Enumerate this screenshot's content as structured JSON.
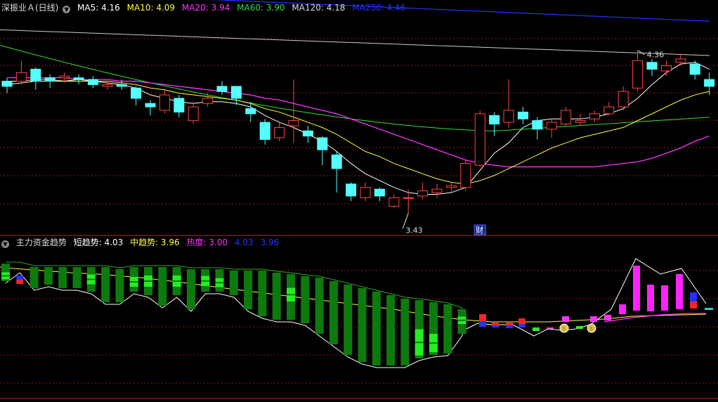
{
  "main_panel": {
    "title": "深振业Ａ(日线)",
    "ma": [
      {
        "label": "MA5: 4.16",
        "color": "#ffffff"
      },
      {
        "label": "MA10: 4.09",
        "color": "#ffff33"
      },
      {
        "label": "MA20: 3.94",
        "color": "#ff33ff"
      },
      {
        "label": "MA60: 3.90",
        "color": "#33dd33"
      },
      {
        "label": "MA120: 4.18",
        "color": "#dddddd"
      },
      {
        "label": "MA250: 4.46",
        "color": "#2233ff"
      }
    ],
    "high_label": "4.36",
    "low_label": "3.43",
    "event_badge": "财",
    "collapse_icon": "chevron-down-icon"
  },
  "sub_panel": {
    "title": "主力资金趋势",
    "items": [
      {
        "label": "短趋势: 4.03",
        "color": "#ffffff"
      },
      {
        "label": "中趋势: 3.96",
        "color": "#ffff33"
      },
      {
        "label": "热度: 3.00",
        "color": "#ff33ff"
      },
      {
        "label": "4.03",
        "color": "#2233ff"
      },
      {
        "label": "3.96",
        "color": "#2233ff"
      }
    ],
    "money_icon": "money-bag-icon"
  },
  "colors": {
    "up": "#ff4444",
    "down": "#54ffff",
    "grid": "#8a1a1a",
    "bg": "#000000"
  },
  "chart_data": {
    "type": "candlestick",
    "ylim": [
      3.3,
      4.6
    ],
    "candles": [
      [
        4.2,
        4.17,
        4.22,
        4.13
      ],
      [
        4.2,
        4.25,
        4.32,
        4.18
      ],
      [
        4.27,
        4.2,
        4.28,
        4.15
      ],
      [
        4.22,
        4.2,
        4.24,
        4.16
      ],
      [
        4.22,
        4.23,
        4.25,
        4.19
      ],
      [
        4.22,
        4.21,
        4.24,
        4.18
      ],
      [
        4.21,
        4.18,
        4.23,
        4.16
      ],
      [
        4.17,
        4.18,
        4.2,
        4.15
      ],
      [
        4.18,
        4.17,
        4.21,
        4.15
      ],
      [
        4.16,
        4.1,
        4.17,
        4.06
      ],
      [
        4.07,
        4.05,
        4.09,
        4.0
      ],
      [
        4.03,
        4.12,
        4.15,
        4.01
      ],
      [
        4.1,
        4.02,
        4.12,
        3.99
      ],
      [
        3.97,
        4.05,
        4.08,
        3.95
      ],
      [
        4.07,
        4.1,
        4.13,
        4.05
      ],
      [
        4.17,
        4.14,
        4.2,
        4.12
      ],
      [
        4.17,
        4.1,
        4.17,
        4.06
      ],
      [
        4.04,
        4.01,
        4.08,
        3.96
      ],
      [
        3.96,
        3.86,
        3.98,
        3.83
      ],
      [
        3.87,
        3.93,
        3.96,
        3.85
      ],
      [
        3.94,
        3.97,
        4.21,
        3.84
      ],
      [
        3.91,
        3.88,
        3.94,
        3.84
      ],
      [
        3.87,
        3.8,
        3.88,
        3.71
      ],
      [
        3.77,
        3.69,
        3.79,
        3.55
      ],
      [
        3.6,
        3.53,
        3.61,
        3.5
      ],
      [
        3.52,
        3.58,
        3.61,
        3.5
      ],
      [
        3.57,
        3.53,
        3.58,
        3.5
      ],
      [
        3.47,
        3.52,
        3.54,
        3.46
      ],
      [
        3.52,
        3.52,
        3.57,
        3.43
      ],
      [
        3.53,
        3.56,
        3.61,
        3.51
      ],
      [
        3.55,
        3.57,
        3.6,
        3.52
      ],
      [
        3.58,
        3.59,
        3.61,
        3.55
      ],
      [
        3.58,
        3.72,
        3.74,
        3.56
      ],
      [
        3.71,
        4.01,
        4.03,
        3.7
      ],
      [
        4.0,
        3.95,
        4.02,
        3.88
      ],
      [
        3.96,
        4.03,
        4.21,
        3.93
      ],
      [
        4.02,
        3.98,
        4.05,
        3.95
      ],
      [
        3.97,
        3.92,
        3.99,
        3.86
      ],
      [
        3.92,
        3.96,
        3.98,
        3.87
      ],
      [
        3.95,
        4.03,
        4.05,
        3.94
      ],
      [
        3.96,
        3.97,
        4.01,
        3.94
      ],
      [
        3.98,
        4.01,
        4.03,
        3.96
      ],
      [
        4.01,
        4.05,
        4.08,
        4.0
      ],
      [
        4.05,
        4.14,
        4.17,
        4.03
      ],
      [
        4.16,
        4.32,
        4.38,
        4.14
      ],
      [
        4.31,
        4.27,
        4.33,
        4.23
      ],
      [
        4.26,
        4.29,
        4.32,
        4.23
      ],
      [
        4.31,
        4.33,
        4.36,
        4.29
      ],
      [
        4.3,
        4.24,
        4.32,
        4.21
      ],
      [
        4.21,
        4.17,
        4.25,
        4.12
      ]
    ],
    "ma5": [
      4.18,
      4.19,
      4.2,
      4.2,
      4.2,
      4.21,
      4.2,
      4.19,
      4.18,
      4.16,
      4.12,
      4.1,
      4.08,
      4.07,
      4.08,
      4.08,
      4.07,
      4.05,
      4.0,
      3.96,
      3.93,
      3.89,
      3.85,
      3.79,
      3.72,
      3.66,
      3.62,
      3.58,
      3.55,
      3.54,
      3.54,
      3.55,
      3.58,
      3.68,
      3.78,
      3.84,
      3.93,
      3.97,
      3.98,
      3.98,
      3.98,
      3.99,
      4.01,
      4.04,
      4.1,
      4.18,
      4.25,
      4.3,
      4.31,
      4.27
    ],
    "ma10": [
      4.2,
      4.2,
      4.21,
      4.21,
      4.2,
      4.2,
      4.2,
      4.2,
      4.19,
      4.18,
      4.16,
      4.15,
      4.13,
      4.12,
      4.11,
      4.1,
      4.09,
      4.07,
      4.04,
      4.02,
      3.99,
      3.96,
      3.93,
      3.89,
      3.84,
      3.79,
      3.76,
      3.72,
      3.69,
      3.66,
      3.63,
      3.61,
      3.6,
      3.62,
      3.65,
      3.69,
      3.73,
      3.77,
      3.81,
      3.84,
      3.87,
      3.89,
      3.91,
      3.93,
      3.97,
      4.01,
      4.05,
      4.09,
      4.12,
      4.14
    ],
    "ma20": [
      4.22,
      4.22,
      4.22,
      4.22,
      4.22,
      4.21,
      4.21,
      4.21,
      4.2,
      4.2,
      4.19,
      4.18,
      4.17,
      4.16,
      4.15,
      4.14,
      4.13,
      4.12,
      4.1,
      4.09,
      4.07,
      4.05,
      4.03,
      4.01,
      3.98,
      3.95,
      3.92,
      3.89,
      3.86,
      3.83,
      3.8,
      3.77,
      3.74,
      3.72,
      3.71,
      3.7,
      3.7,
      3.7,
      3.7,
      3.7,
      3.7,
      3.7,
      3.71,
      3.72,
      3.73,
      3.75,
      3.78,
      3.81,
      3.85,
      3.88
    ],
    "ma60_start": 4.41,
    "ma60_low": 3.91,
    "ma60_end": 3.99,
    "ma120_start": 4.5,
    "ma120_end": 4.35,
    "ma250_start": 4.73,
    "ma250_end": 4.55,
    "fund_bars": [
      {
        "color": "green",
        "top": 20,
        "bottom": 45,
        "inner": [
          0.5,
          0.9
        ]
      },
      {
        "color": "mixed",
        "top": 20,
        "bottom": 30
      },
      {
        "color": "green",
        "top": 25,
        "bottom": 55
      },
      {
        "color": "green",
        "top": 25,
        "bottom": 50
      },
      {
        "color": "green",
        "top": 25,
        "bottom": 55
      },
      {
        "color": "green",
        "top": 25,
        "bottom": 55
      },
      {
        "color": "green",
        "top": 25,
        "bottom": 60,
        "inner": [
          0.3,
          0.7
        ]
      },
      {
        "color": "green",
        "top": 25,
        "bottom": 75
      },
      {
        "color": "green",
        "top": 28,
        "bottom": 75
      },
      {
        "color": "green",
        "top": 25,
        "bottom": 60,
        "inner": [
          0.4,
          0.8
        ]
      },
      {
        "color": "green",
        "top": 25,
        "bottom": 65,
        "inner": [
          0.3,
          0.7
        ]
      },
      {
        "color": "green",
        "top": 25,
        "bottom": 80
      },
      {
        "color": "green",
        "top": 25,
        "bottom": 65,
        "inner": [
          0.3,
          0.7
        ]
      },
      {
        "color": "green",
        "top": 28,
        "bottom": 85
      },
      {
        "color": "green",
        "top": 28,
        "bottom": 60,
        "inner": [
          0.3,
          0.75
        ]
      },
      {
        "color": "green",
        "top": 28,
        "bottom": 60,
        "inner": [
          0.4,
          0.8
        ]
      },
      {
        "color": "green",
        "top": 30,
        "bottom": 65
      },
      {
        "color": "green",
        "top": 30,
        "bottom": 85
      },
      {
        "color": "green",
        "top": 30,
        "bottom": 95
      },
      {
        "color": "green",
        "top": 33,
        "bottom": 100
      },
      {
        "color": "green",
        "top": 35,
        "bottom": 100,
        "inner": [
          0.3,
          0.6
        ]
      },
      {
        "color": "green",
        "top": 38,
        "bottom": 105
      },
      {
        "color": "green",
        "top": 40,
        "bottom": 120
      },
      {
        "color": "green",
        "top": 45,
        "bottom": 135
      },
      {
        "color": "green",
        "top": 50,
        "bottom": 150
      },
      {
        "color": "green",
        "top": 55,
        "bottom": 160
      },
      {
        "color": "green",
        "top": 60,
        "bottom": 165
      },
      {
        "color": "green",
        "top": 65,
        "bottom": 165
      },
      {
        "color": "green",
        "top": 70,
        "bottom": 165
      },
      {
        "color": "green",
        "top": 72,
        "bottom": 155,
        "inner": [
          0.5,
          0.95
        ]
      },
      {
        "color": "green",
        "top": 75,
        "bottom": 150,
        "inner": [
          0.6,
          0.95
        ]
      },
      {
        "color": "green",
        "top": 78,
        "bottom": 148
      },
      {
        "color": "green",
        "top": 85,
        "bottom": 120,
        "inner": [
          0.3,
          0.6
        ]
      }
    ]
  }
}
